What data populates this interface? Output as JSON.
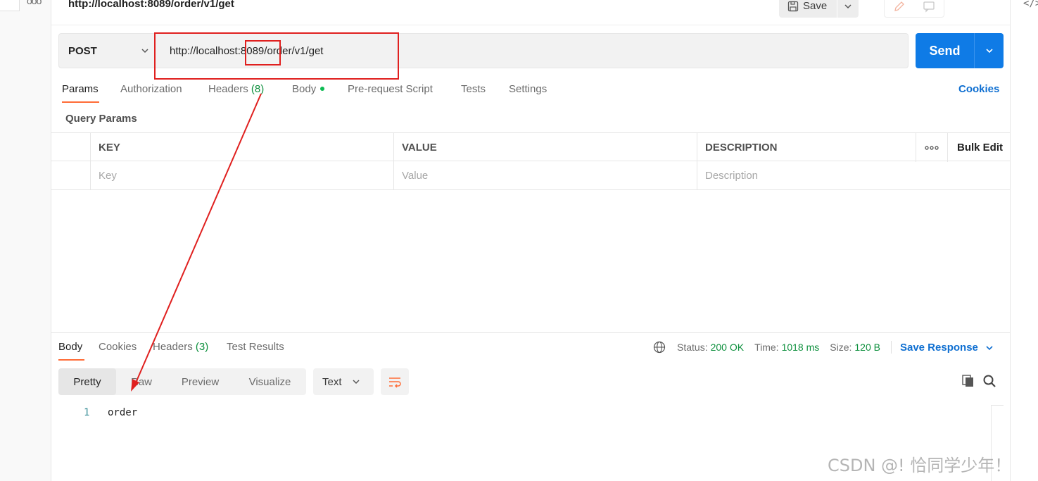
{
  "request": {
    "title": "http://localhost:8089/order/v1/get",
    "save_label": "Save",
    "method": "POST",
    "url": "http://localhost:8089/order/v1/get",
    "send_label": "Send"
  },
  "request_tabs": {
    "params": "Params",
    "authorization": "Authorization",
    "headers": "Headers",
    "headers_count": "(8)",
    "body": "Body",
    "pre_request": "Pre-request Script",
    "tests": "Tests",
    "settings": "Settings",
    "cookies": "Cookies"
  },
  "query_params": {
    "title": "Query Params",
    "columns": [
      "KEY",
      "VALUE",
      "DESCRIPTION"
    ],
    "bulk_edit": "Bulk Edit",
    "placeholders": {
      "key": "Key",
      "value": "Value",
      "description": "Description"
    }
  },
  "response": {
    "tabs": {
      "body": "Body",
      "cookies": "Cookies",
      "headers": "Headers",
      "headers_count": "(3)",
      "test_results": "Test Results"
    },
    "status_label": "Status:",
    "status_value": "200 OK",
    "time_label": "Time:",
    "time_value": "1018 ms",
    "size_label": "Size:",
    "size_value": "120 B",
    "save_response": "Save Response",
    "views": [
      "Pretty",
      "Raw",
      "Preview",
      "Visualize"
    ],
    "active_view": "Pretty",
    "format": "Text",
    "lines": [
      {
        "num": "1",
        "text": "order"
      }
    ]
  },
  "watermark": "CSDN @! 恰同学少年！",
  "colors": {
    "accent": "#ff6c37",
    "send_blue": "#0f7be6",
    "link_blue": "#0f6fd1",
    "status_green": "#0c8f3c",
    "annotation_red": "#e0201f"
  },
  "icons": [
    "more-dots-icon",
    "code-icon",
    "save-disk-icon",
    "chevron-down-icon",
    "pencil-icon",
    "comment-icon",
    "globe-icon",
    "wrap-lines-icon",
    "copy-icon",
    "search-icon"
  ]
}
